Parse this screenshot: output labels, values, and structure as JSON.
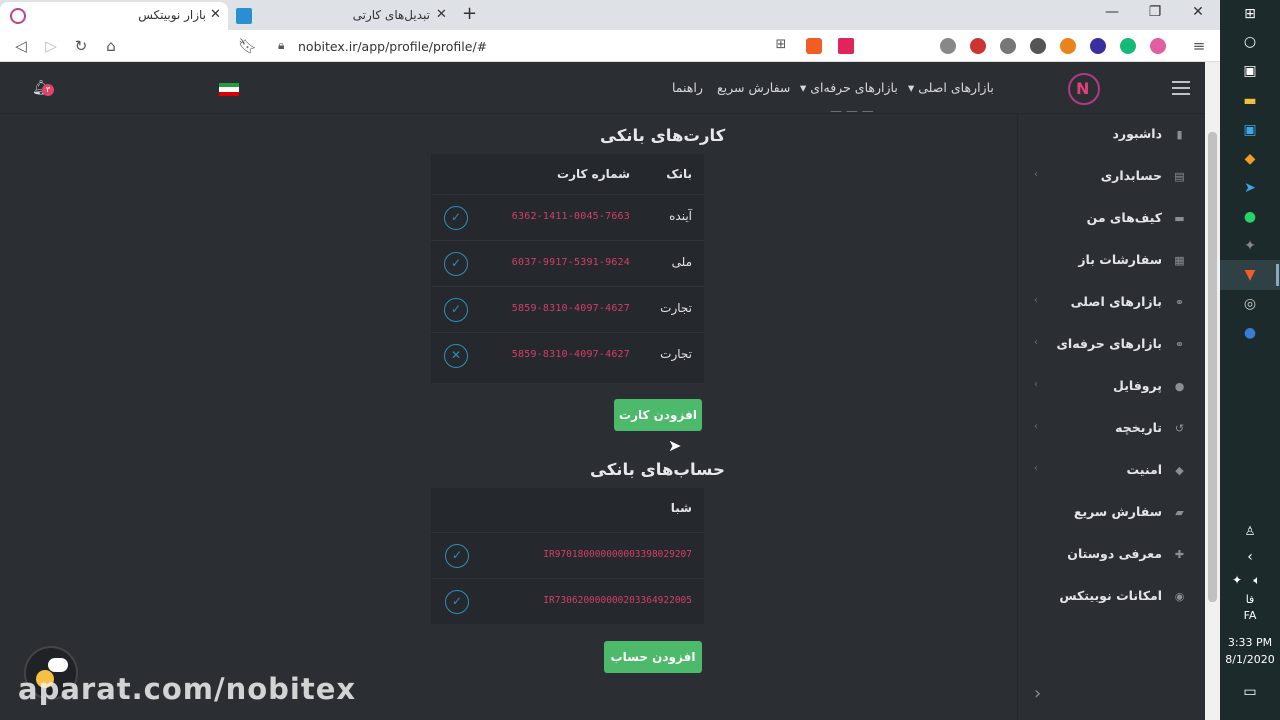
{
  "browser": {
    "tabs": [
      {
        "label": "بازار نوبیتکس",
        "active": true
      },
      {
        "label": "تبدیل‌های کارتی",
        "active": false
      }
    ],
    "new_tab": "+",
    "url": "nobitex.ir/app/profile/profile/#",
    "window": {
      "minimize": "—",
      "restore": "❐",
      "close": "✕"
    }
  },
  "nav": {
    "main_markets": "بازارهای اصلی",
    "pro_markets": "بازارهای حرفه‌ای",
    "quick_order": "سفارش سریع",
    "guide": "راهنما",
    "notification_count": "۳"
  },
  "sidebar": {
    "items": [
      {
        "label": "داشبورد",
        "icon": "dashboard-icon",
        "chevron": false
      },
      {
        "label": "حسابداری",
        "icon": "accounting-icon",
        "chevron": true
      },
      {
        "label": "کیف‌های من",
        "icon": "wallet-icon",
        "chevron": false
      },
      {
        "label": "سفارشات باز",
        "icon": "orders-icon",
        "chevron": false
      },
      {
        "label": "بازارهای اصلی",
        "icon": "handshake-icon",
        "chevron": true
      },
      {
        "label": "بازارهای حرفه‌ای",
        "icon": "handshake-icon",
        "chevron": true
      },
      {
        "label": "پروفایل",
        "icon": "user-icon",
        "chevron": true
      },
      {
        "label": "تاریخچه",
        "icon": "history-icon",
        "chevron": true
      },
      {
        "label": "امنیت",
        "icon": "shield-icon",
        "chevron": true
      },
      {
        "label": "سفارش سریع",
        "icon": "truck-icon",
        "chevron": false
      },
      {
        "label": "معرفی دوستان",
        "icon": "user-plus-icon",
        "chevron": false
      },
      {
        "label": "امکانات نوبیتکس",
        "icon": "gamepad-icon",
        "chevron": false
      }
    ]
  },
  "cards": {
    "title": "کارت‌های بانکی",
    "col_bank": "بانک",
    "col_number": "شماره کارت",
    "rows": [
      {
        "bank": "آینده",
        "number": "6362-1411-0045-7663",
        "verified": true
      },
      {
        "bank": "ملی",
        "number": "6037-9917-5391-9624",
        "verified": true
      },
      {
        "bank": "تجارت",
        "number": "5859-8310-4097-4627",
        "verified": true
      },
      {
        "bank": "تجارت",
        "number": "5859-8310-4097-4627",
        "verified": false
      }
    ],
    "add_button": "افزودن کارت"
  },
  "accounts": {
    "title": "حساب‌های بانکی",
    "col_sheba": "شبا",
    "rows": [
      {
        "sheba": "IR970180000000003398029207",
        "verified": true
      },
      {
        "sheba": "IR730620000000203364922005",
        "verified": true
      }
    ],
    "add_button": "افزودن حساب"
  },
  "watermark": "aparat.com/nobitex",
  "taskbar": {
    "lang_top": "فا",
    "lang_bottom": "FA",
    "time": "3:33 PM",
    "date": "8/1/2020"
  },
  "colors": {
    "accent_green": "#4cba6a",
    "card_number_red": "#d33f67",
    "verified_blue": "#2f8fb5",
    "background": "#2b2e33"
  }
}
